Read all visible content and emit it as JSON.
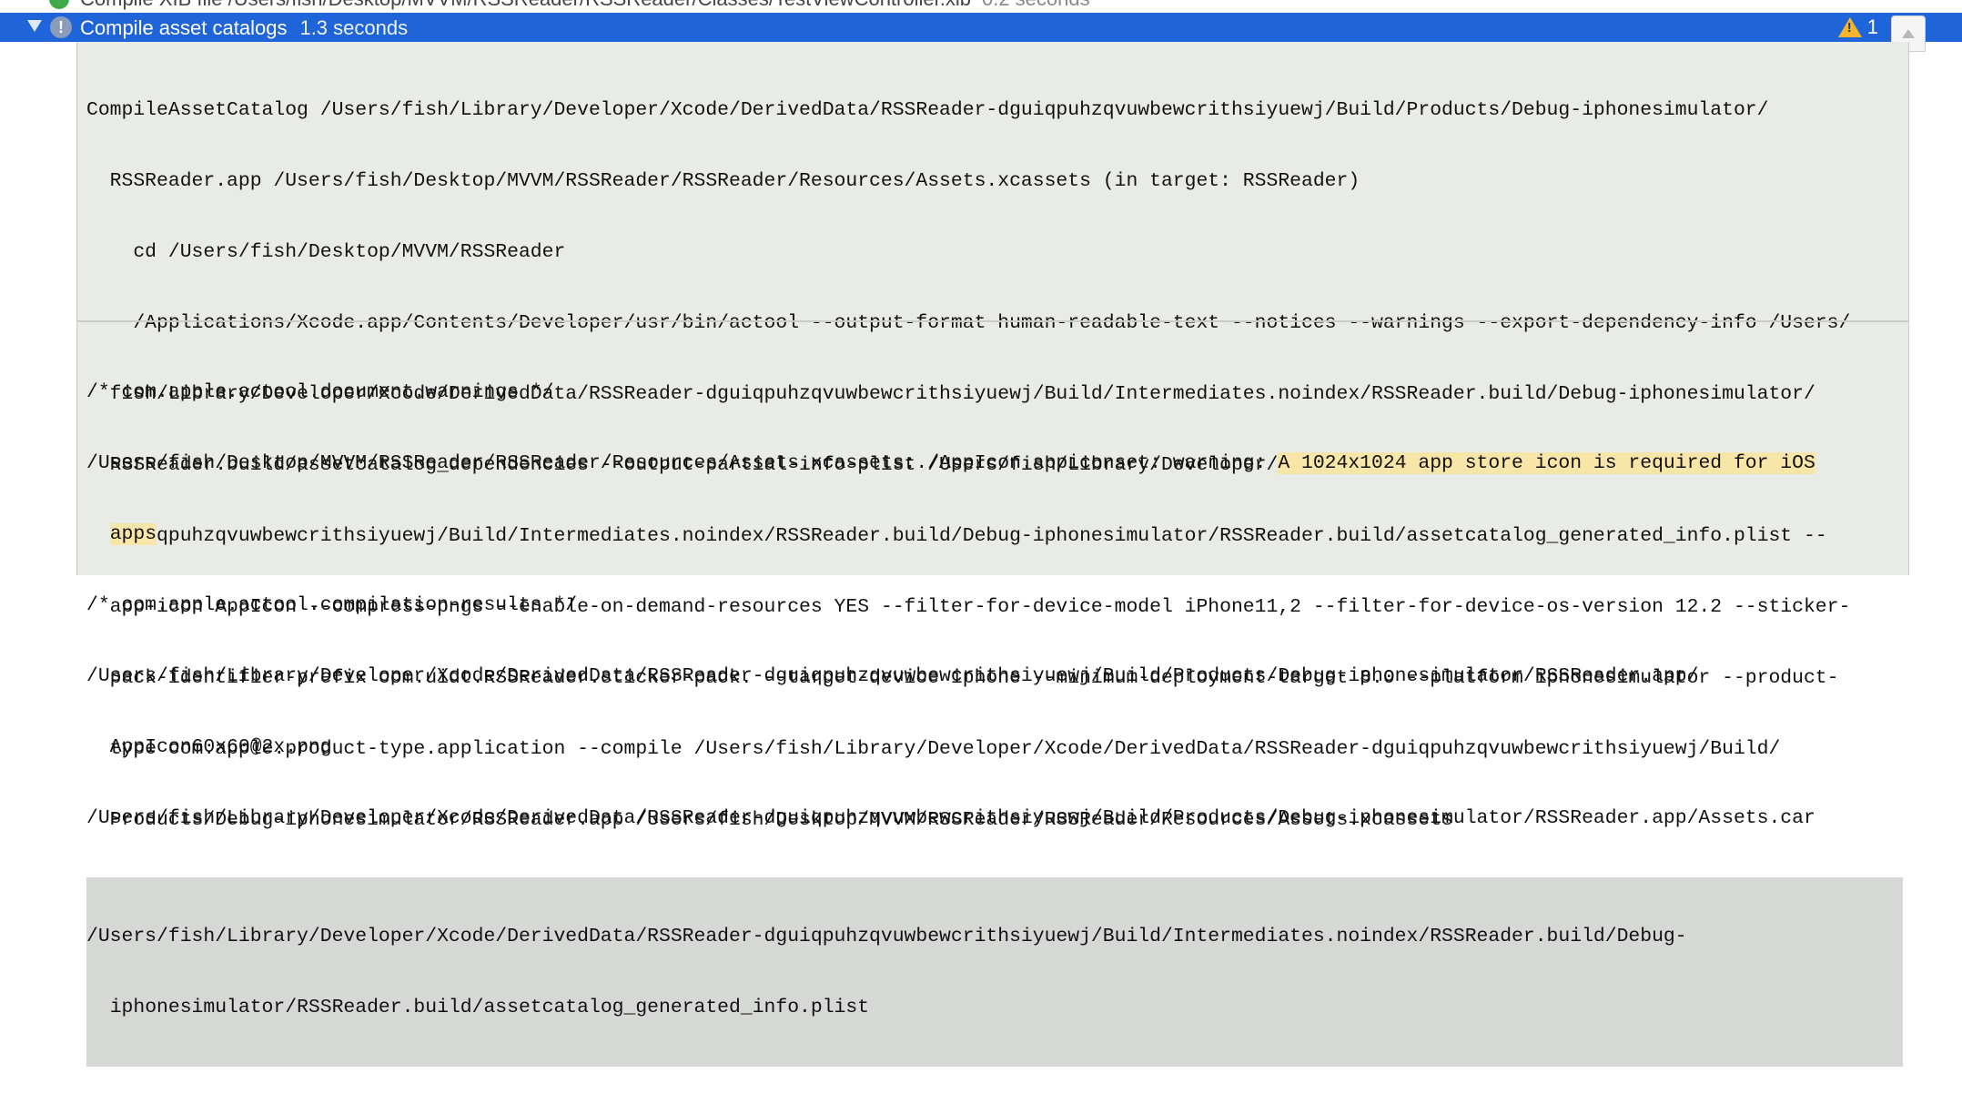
{
  "previous_step": {
    "title": "Compile XIB file /Users/fish/Desktop/MVVM/RSSReader/RSSReader/Classes/TestViewController.xib",
    "duration": "0.2 seconds"
  },
  "step": {
    "title": "Compile asset catalogs",
    "duration": "1.3 seconds",
    "warning_count": "1",
    "status_icon": "exclamation-icon",
    "warning_icon": "warning-triangle-icon",
    "collapse_icon": "chevron-up-icon"
  },
  "command": {
    "lines": [
      "CompileAssetCatalog /Users/fish/Library/Developer/Xcode/DerivedData/RSSReader-dguiqpuhzqvuwbewcrithsiyuewj/Build/Products/Debug-iphonesimulator/",
      "  RSSReader.app /Users/fish/Desktop/MVVM/RSSReader/RSSReader/Resources/Assets.xcassets (in target: RSSReader)",
      "    cd /Users/fish/Desktop/MVVM/RSSReader",
      "    /Applications/Xcode.app/Contents/Developer/usr/bin/actool --output-format human-readable-text --notices --warnings --export-dependency-info /Users/",
      "  fish/Library/Developer/Xcode/DerivedData/RSSReader-dguiqpuhzqvuwbewcrithsiyuewj/Build/Intermediates.noindex/RSSReader.build/Debug-iphonesimulator/",
      "  RSSReader.build/assetcatalog_dependencies --output-partial-info-plist /Users/fish/Library/Developer/Xcode/DerivedData/RSSReader-",
      "  dguiqpuhzqvuwbewcrithsiyuewj/Build/Intermediates.noindex/RSSReader.build/Debug-iphonesimulator/RSSReader.build/assetcatalog_generated_info.plist --",
      "  app-icon AppIcon --compress-pngs --enable-on-demand-resources YES --filter-for-device-model iPhone11,2 --filter-for-device-os-version 12.2 --sticker-",
      "  pack-identifier-prefix com.uidt.RSSReader.sticker-pack. --target-device iphone --minimum-deployment-target 8.0 --platform iphonesimulator --product-",
      "  type com.apple.product-type.application --compile /Users/fish/Library/Developer/Xcode/DerivedData/RSSReader-dguiqpuhzqvuwbewcrithsiyuewj/Build/",
      "  Products/Debug-iphonesimulator/RSSReader.app /Users/fish/Desktop/MVVM/RSSReader/RSSReader/Resources/Assets.xcassets"
    ]
  },
  "output": {
    "warnings_header": "/* com.apple.actool.document.warnings */",
    "warning_location": "/Users/fish/Desktop/MVVM/RSSReader/RSSReader/Resources/Assets.xcassets:./AppIcon.appiconset: warning: ",
    "warning_message_1": "A 1024x1024 app store icon is required for iOS",
    "warning_message_2": "apps",
    "results_header": "/* com.apple.actool.compilation-results */",
    "result_1a": "/Users/fish/Library/Developer/Xcode/DerivedData/RSSReader-dguiqpuhzqvuwbewcrithsiyuewj/Build/Products/Debug-iphonesimulator/RSSReader.app/",
    "result_1b": "AppIcon60x60@2x.png",
    "result_2": "/Users/fish/Library/Developer/Xcode/DerivedData/RSSReader-dguiqpuhzqvuwbewcrithsiyuewj/Build/Products/Debug-iphonesimulator/RSSReader.app/Assets.car",
    "result_3a": "/Users/fish/Library/Developer/Xcode/DerivedData/RSSReader-dguiqpuhzqvuwbewcrithsiyuewj/Build/Intermediates.noindex/RSSReader.build/Debug-",
    "result_3b": "iphonesimulator/RSSReader.build/assetcatalog_generated_info.plist"
  }
}
